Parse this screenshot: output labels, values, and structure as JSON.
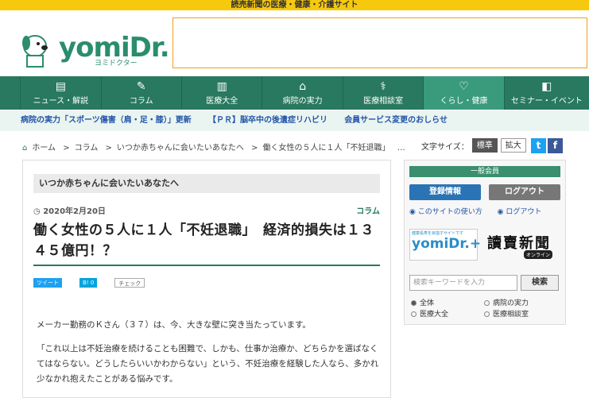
{
  "topbar": {
    "text": "読売新聞の医療・健康・介護サイト"
  },
  "logo": {
    "name": "yomiDr.",
    "sub": "ヨミドクター"
  },
  "gnav": {
    "items": [
      {
        "label": "ニュース・解説"
      },
      {
        "label": "コラム"
      },
      {
        "label": "医療大全"
      },
      {
        "label": "病院の実力"
      },
      {
        "label": "医療相談室"
      },
      {
        "label": "くらし・健康"
      },
      {
        "label": "セミナー・イベント"
      }
    ]
  },
  "subnav": {
    "items": [
      {
        "label": "病院の実力「スポーツ傷害（肩・足・膝）」更新"
      },
      {
        "label": "【ＰＲ】脳卒中の後遺症リハビリ"
      },
      {
        "label": "会員サービス変更のおしらせ"
      }
    ]
  },
  "breadcrumb": {
    "items": [
      "ホーム",
      "コラム",
      "いつか赤ちゃんに会いたいあなたへ",
      "働く女性の５人に１人「不妊退職」",
      "…"
    ],
    "sep": ">"
  },
  "fontsize": {
    "label": "文字サイズ：",
    "standard": "標準",
    "large": "拡大"
  },
  "article": {
    "series": "いつか赤ちゃんに会いたいあなたへ",
    "date": "2020年2月20日",
    "category": "コラム",
    "title": "働く女性の５人に１人「不妊退職」　経済的損失は１３４５億円！？",
    "share": {
      "tweet": "ツイート",
      "hatena": "B! 0",
      "check": "チェック"
    },
    "paragraphs": [
      "メーカー勤務のＫさん（３７）は、今、大きな壁に突き当たっています。",
      "「これ以上は不妊治療を続けることも困難で、しかも、仕事か治療か、どちらかを選ばなくてはならない。どうしたらいいかわからない」という、不妊治療を経験した人なら、多かれ少なかれ抱えたことがある悩みです。"
    ]
  },
  "sidebar": {
    "member_label": "一般会員",
    "register": "登録情報",
    "logout_btn": "ログアウト",
    "link_usage": "このサイトの使い方",
    "link_logout": "ログアウト",
    "plus_sub": "健康長寿を目指すサイトです",
    "plus_name": "yomiDr.+",
    "yomiuri": "讀賣新聞",
    "online": "オンライン",
    "search_placeholder": "検索キーワードを入力",
    "search_button": "検索",
    "options": [
      "全体",
      "病院の実力",
      "医療大全",
      "医療相談室"
    ]
  },
  "colors": {
    "brand_green": "#28795f",
    "top_yellow": "#f6c90e",
    "link_blue": "#2255aa"
  }
}
